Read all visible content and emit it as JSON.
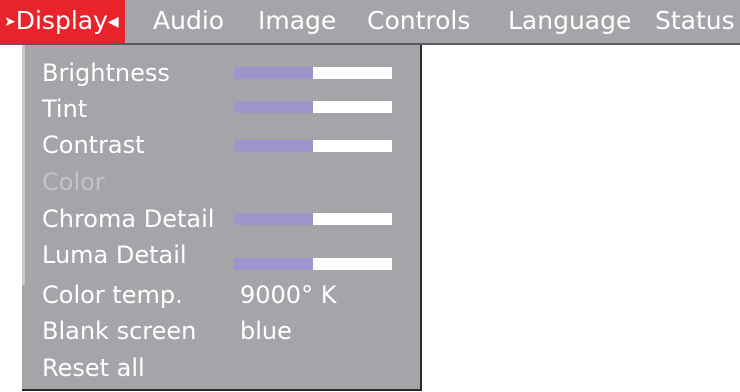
{
  "menu": {
    "tabs": [
      {
        "label": "Display",
        "active": true,
        "marker_left": "➤",
        "marker_right": "◀"
      },
      {
        "label": "Audio"
      },
      {
        "label": "Image"
      },
      {
        "label": "Controls"
      },
      {
        "label": "Language"
      },
      {
        "label": "Status"
      }
    ]
  },
  "display": {
    "items": [
      {
        "label": "Brightness",
        "slider_level": 0.5
      },
      {
        "label": "Tint",
        "slider_level": 0.5
      },
      {
        "label": "Contrast",
        "slider_level": 0.5
      },
      {
        "label": "Color",
        "disabled": true
      },
      {
        "label": "Chroma Detail",
        "slider_level": 0.5
      },
      {
        "label": "Luma Detail",
        "slider_level": 0.5
      },
      {
        "label": "Color temp.",
        "value": "9000° K"
      },
      {
        "label": "Blank screen",
        "value": "blue"
      },
      {
        "label": "Reset all"
      }
    ]
  },
  "colors": {
    "menu_bg": "#a5a5a9",
    "active_tab": "#e8232c",
    "slider_fill": "#9c96cc",
    "slider_track": "#ffffff",
    "text": "#ffffff",
    "disabled_text": "#c4c4c7"
  }
}
